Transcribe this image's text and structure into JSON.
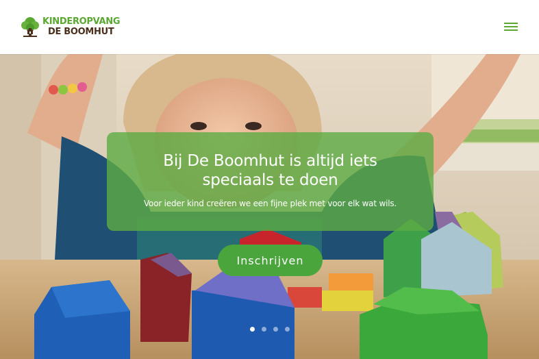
{
  "header": {
    "logo": {
      "line1": "KINDEROPVANG",
      "line2": "DE BOOMHUT",
      "icon": "tree-house-icon",
      "colors": {
        "green": "#5aa832",
        "brown": "#4a2f1c"
      }
    },
    "menu_icon": "hamburger-menu-icon"
  },
  "hero": {
    "heading_line1": "Bij De Boomhut is altijd iets",
    "heading_line2": "speciaals te doen",
    "subtitle": "Voor ieder kind creëren we een fijne plek met voor elk wat wils.",
    "button_label": "Inschrijven",
    "caption_color": "#5cab43",
    "button_color": "#4aa63c",
    "slides": {
      "count": 4,
      "active": 1
    }
  }
}
